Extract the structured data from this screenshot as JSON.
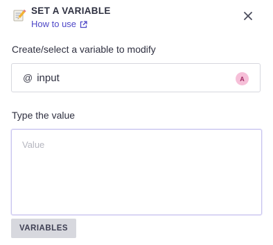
{
  "header": {
    "icon": "memo-pencil-icon",
    "title": "SET A VARIABLE",
    "help_link": "How to use",
    "help_link_icon": "external-link-icon",
    "close_icon": "close-icon"
  },
  "variable_field": {
    "label": "Create/select a variable to modify",
    "prefix": "@",
    "value": "input",
    "badge": "A"
  },
  "value_field": {
    "label": "Type the value",
    "placeholder": "Value",
    "value": ""
  },
  "footer": {
    "variables_button": "VARIABLES"
  },
  "colors": {
    "link": "#4d46c7",
    "badge_bg": "#f6bfd8",
    "badge_text": "#a12a63",
    "button_bg": "#d7d8de",
    "focus_border": "#c7c3ee"
  }
}
